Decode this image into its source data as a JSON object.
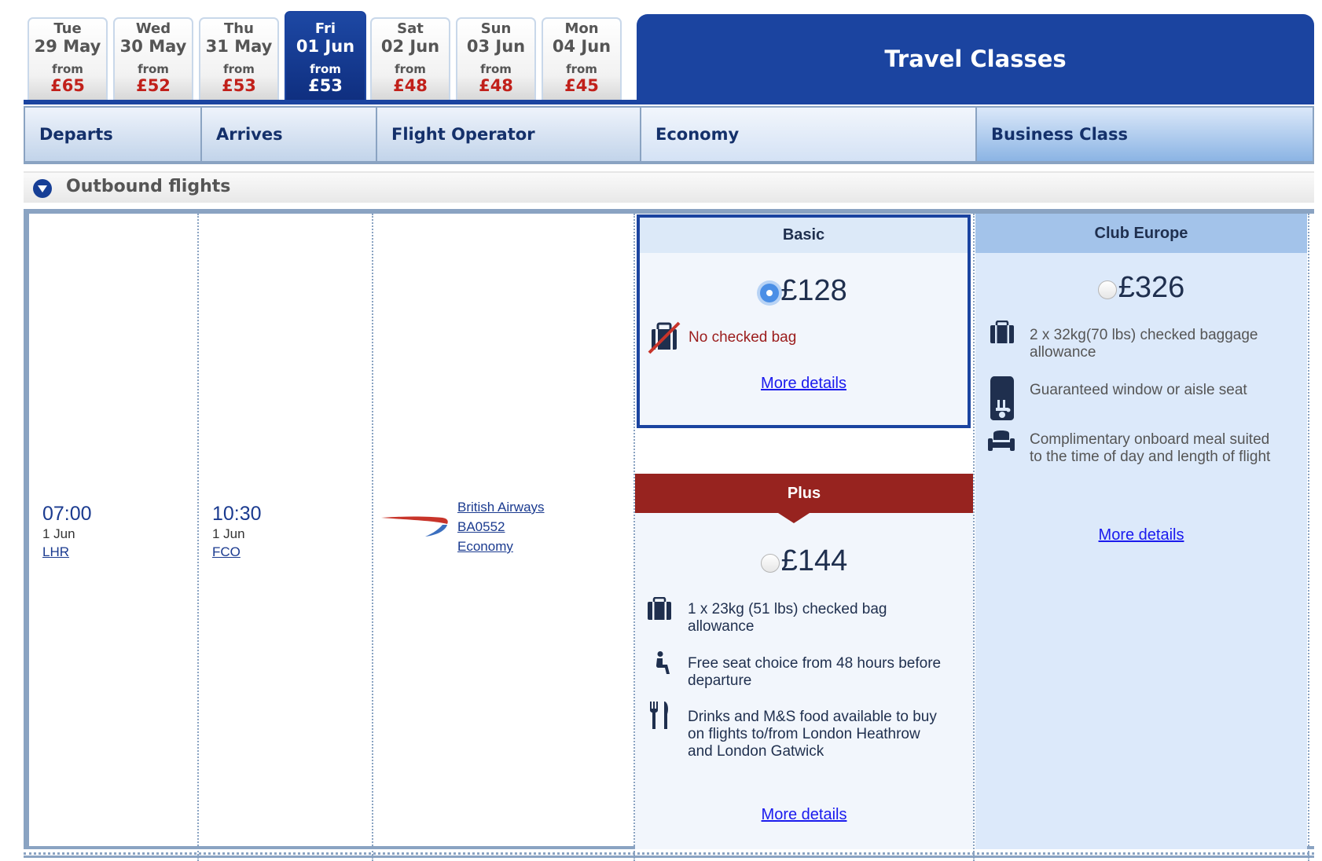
{
  "date_tabs": [
    {
      "day": "Tue",
      "date": "29 May",
      "from_label": "from",
      "price": "£65",
      "selected": false
    },
    {
      "day": "Wed",
      "date": "30 May",
      "from_label": "from",
      "price": "£52",
      "selected": false
    },
    {
      "day": "Thu",
      "date": "31 May",
      "from_label": "from",
      "price": "£53",
      "selected": false
    },
    {
      "day": "Fri",
      "date": "01 Jun",
      "from_label": "from",
      "price": "£53",
      "selected": true
    },
    {
      "day": "Sat",
      "date": "02 Jun",
      "from_label": "from",
      "price": "£48",
      "selected": false
    },
    {
      "day": "Sun",
      "date": "03 Jun",
      "from_label": "from",
      "price": "£48",
      "selected": false
    },
    {
      "day": "Mon",
      "date": "04 Jun",
      "from_label": "from",
      "price": "£45",
      "selected": false
    }
  ],
  "travel_classes_title": "Travel Classes",
  "columns": {
    "departs": "Departs",
    "arrives": "Arrives",
    "operator": "Flight Operator",
    "economy": "Economy",
    "business": "Business Class"
  },
  "section": {
    "label": "Outbound flights",
    "icon": "chevron-down-circle-icon"
  },
  "flight": {
    "depart_time": "07:00",
    "depart_date": "1 Jun",
    "depart_airport": "LHR",
    "arrive_time": "10:30",
    "arrive_date": "1 Jun",
    "arrive_airport": "FCO",
    "airline": "British Airways",
    "flight_number": "BA0552",
    "cabin": "Economy",
    "logo": "british-airways-speedmarque-logo"
  },
  "fares": {
    "basic": {
      "title": "Basic",
      "price": "£128",
      "selected": true,
      "features": [
        {
          "icon": "no-bag-icon",
          "text": "No checked bag"
        }
      ],
      "more_details": "More details"
    },
    "plus": {
      "title": "Plus",
      "price": "£144",
      "selected": false,
      "features": [
        {
          "icon": "luggage-icon",
          "text": "1 x 23kg (51 lbs) checked bag allowance"
        },
        {
          "icon": "seat-person-icon",
          "text": "Free seat choice from 48 hours before departure"
        },
        {
          "icon": "cutlery-icon",
          "text": "Drinks and M&S food available to buy on flights to/from London Heathrow and London Gatwick"
        }
      ],
      "more_details": "More details"
    },
    "club_europe": {
      "title": "Club Europe",
      "price": "£326",
      "selected": false,
      "features": [
        {
          "icon": "luggage-icon",
          "text": "2 x 32kg(70 lbs) checked baggage allowance"
        },
        {
          "icon": "window-seat-icon",
          "text": "Guaranteed window or aisle seat"
        },
        {
          "icon": "meal-icon",
          "text": "Complimentary onboard meal suited to the time of day and length of flight"
        }
      ],
      "more_details": "More details"
    }
  },
  "colors": {
    "brand_blue": "#1b44a0",
    "price_red": "#c1201a",
    "plus_red": "#97231f",
    "link_blue": "#1a1aee",
    "border_blue_gray": "#8aa3c2"
  }
}
